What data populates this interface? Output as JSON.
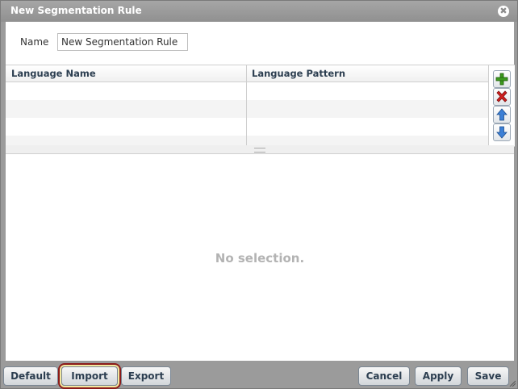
{
  "dialog": {
    "title": "New Segmentation Rule",
    "close_icon_glyph": "✖"
  },
  "form": {
    "name_label": "Name",
    "name_value": "New Segmentation Rule"
  },
  "table": {
    "columns": [
      "Language Name",
      "Language Pattern"
    ],
    "rows": []
  },
  "side_buttons": [
    "add-icon",
    "delete-icon",
    "move-up-icon",
    "move-down-icon"
  ],
  "detail": {
    "empty_text": "No selection."
  },
  "footer": {
    "default_label": "Default",
    "import_label": "Import",
    "export_label": "Export",
    "cancel_label": "Cancel",
    "apply_label": "Apply",
    "save_label": "Save"
  },
  "colors": {
    "accent_add": "#3c9a1e",
    "accent_delete": "#d11f1f",
    "accent_arrow": "#3b7fd6",
    "highlight": "#8b1a1a"
  }
}
